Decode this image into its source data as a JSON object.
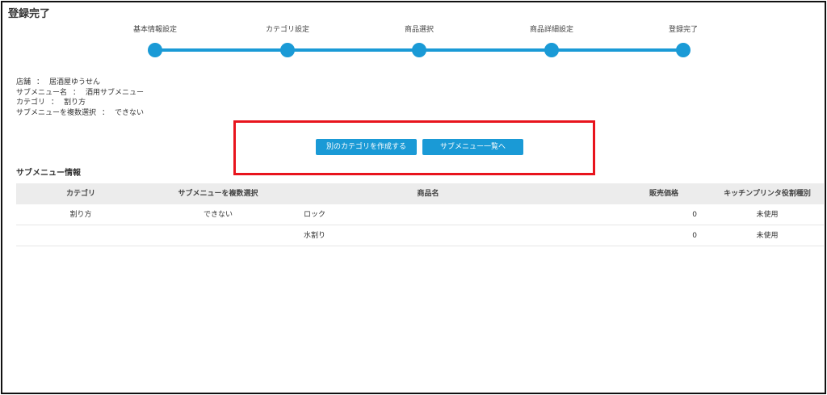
{
  "page": {
    "title": "登録完了"
  },
  "steps": [
    {
      "label": "基本情報設定"
    },
    {
      "label": "カテゴリ設定"
    },
    {
      "label": "商品選択"
    },
    {
      "label": "商品詳細設定"
    },
    {
      "label": "登録完了"
    }
  ],
  "summary": {
    "store_label": "店舗",
    "store_value": "居酒屋ゆうせん",
    "submenu_name_label": "サブメニュー名",
    "submenu_name_value": "酒用サブメニュー",
    "category_label": "カテゴリ",
    "category_value": "割り方",
    "multi_select_label": "サブメニューを複数選択",
    "multi_select_value": "できない",
    "separator": "："
  },
  "actions": {
    "create_category_label": "別のカテゴリを作成する",
    "submenu_list_label": "サブメニュー一覧へ"
  },
  "colors": {
    "accent": "#1a9ad6",
    "highlight_box": "#e8141d"
  },
  "submenu_info": {
    "title": "サブメニュー情報",
    "headers": {
      "category": "カテゴリ",
      "multi_select": "サブメニューを複数選択",
      "item_name": "商品名",
      "price": "販売価格",
      "printer": "キッチンプリンタ役割種別"
    },
    "rows": [
      {
        "category": "割り方",
        "multi_select": "できない",
        "item_name": "ロック",
        "price": "0",
        "printer": "未使用"
      },
      {
        "category": "",
        "multi_select": "",
        "item_name": "水割り",
        "price": "0",
        "printer": "未使用"
      }
    ]
  }
}
